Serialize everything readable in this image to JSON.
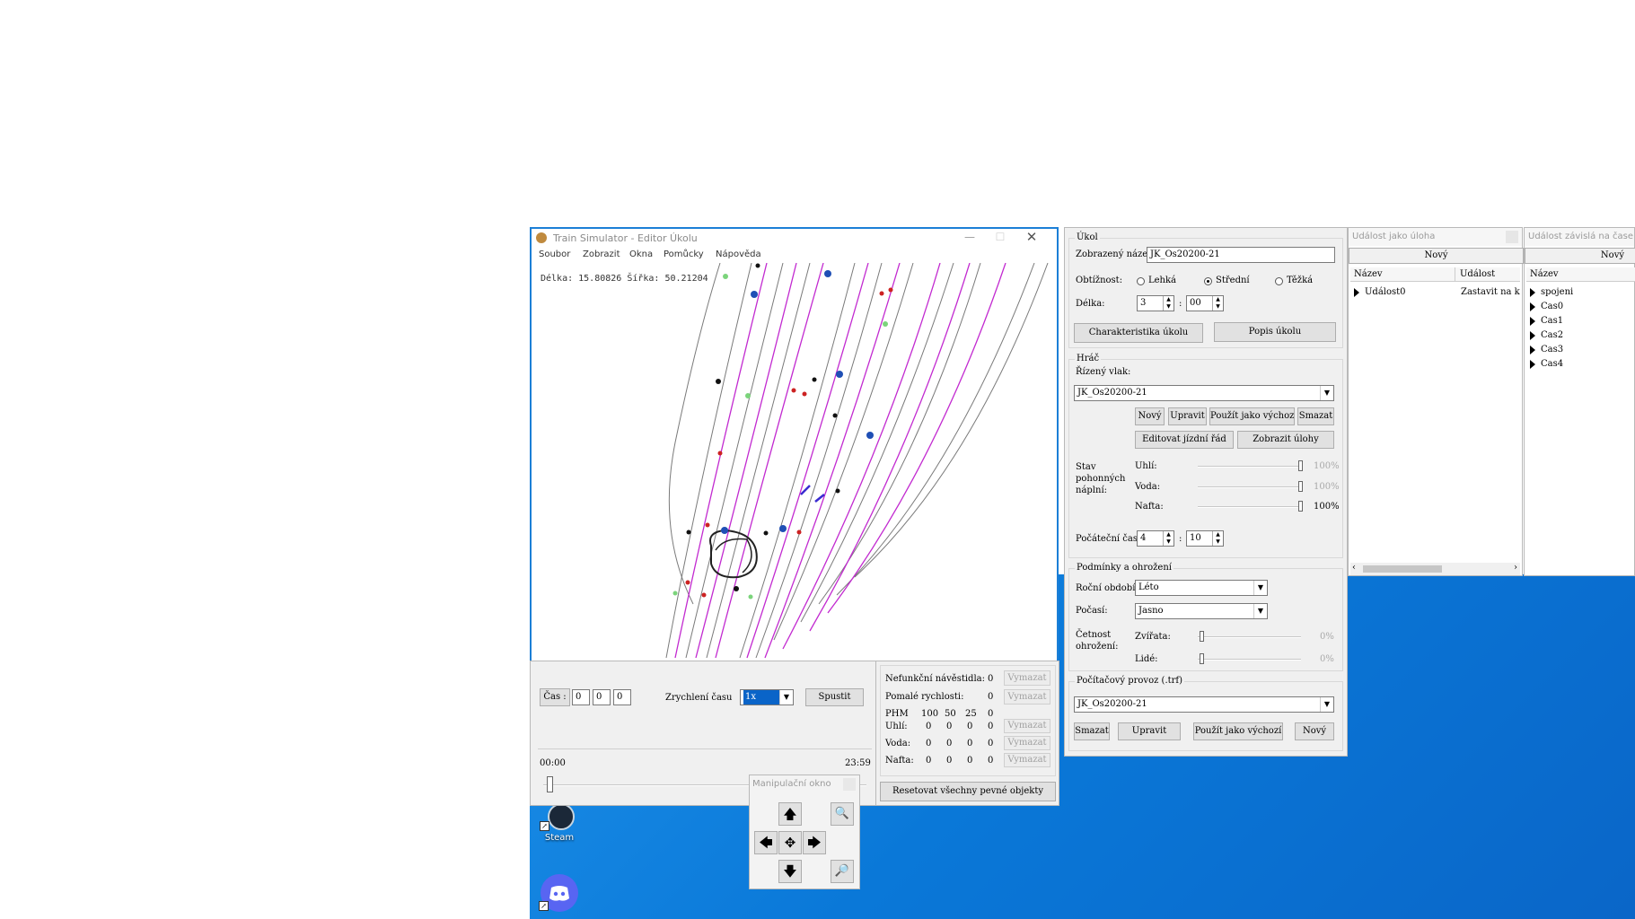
{
  "editor": {
    "title": "Train Simulator - Editor Úkolu",
    "menu": [
      "Soubor",
      "Zobrazit",
      "Okna",
      "Pomůcky",
      "Nápověda"
    ],
    "coords_text": "Délka: 15.80826 Šířka: 50.21204"
  },
  "time_panel": {
    "cas_label": "Čas :",
    "cas_values": [
      "0",
      "0",
      "0"
    ],
    "speed_label": "Zrychlení času",
    "speed_value": "1x",
    "start_button": "Spustit",
    "time_start": "00:00",
    "time_end": "23:59"
  },
  "faults_panel": {
    "rows": [
      {
        "label": "Nefunkční návěstidla:",
        "value": "0",
        "button": "Vymazat"
      },
      {
        "label": "Pomalé rychlosti:",
        "value": "0",
        "button": "Vymazat"
      }
    ],
    "phm_label": "PHM",
    "phm_headers": [
      "100",
      "50",
      "25",
      "0"
    ],
    "fuel_rows": [
      {
        "label": "Uhlí:",
        "values": [
          "0",
          "0",
          "0",
          "0"
        ],
        "button": "Vymazat"
      },
      {
        "label": "Voda:",
        "values": [
          "0",
          "0",
          "0",
          "0"
        ],
        "button": "Vymazat"
      },
      {
        "label": "Nafta:",
        "values": [
          "0",
          "0",
          "0",
          "0"
        ],
        "button": "Vymazat"
      }
    ],
    "reset_button": "Resetovat všechny pevné objekty"
  },
  "manip": {
    "title": "Manipulační okno"
  },
  "task_panel": {
    "ukol_title": "Úkol",
    "display_name_label": "Zobrazený název:",
    "display_name_value": "JK_Os20200-21",
    "difficulty_label": "Obtížnost:",
    "difficulty_options": [
      "Lehká",
      "Střední",
      "Těžká"
    ],
    "difficulty_selected": 1,
    "length_label": "Délka:",
    "length_h": "3",
    "length_m": "00",
    "char_button": "Charakteristika úkolu",
    "desc_button": "Popis úkolu",
    "hrac_title": "Hráč",
    "train_label": "Řízený vlak:",
    "train_value": "JK_Os20200-21",
    "train_buttons": [
      "Nový",
      "Upravit",
      "Použít jako výchozí",
      "Smazat"
    ],
    "timetable_button": "Editovat jízdní řád",
    "show_tasks_button": "Zobrazit úlohy",
    "fuel_label": "Stav pohonných náplní:",
    "fuel_items": [
      {
        "label": "Uhlí:",
        "value": "100%",
        "muted": true
      },
      {
        "label": "Voda:",
        "value": "100%",
        "muted": true
      },
      {
        "label": "Nafta:",
        "value": "100%",
        "muted": false
      }
    ],
    "start_time_label": "Počáteční čas:",
    "start_h": "4",
    "start_m": "10",
    "cond_title": "Podmínky a ohrožení",
    "season_label": "Roční období:",
    "season_value": "Léto",
    "weather_label": "Počasí:",
    "weather_value": "Jasno",
    "threat_label": "Četnost ohrožení:",
    "threat_items": [
      {
        "label": "Zvířata:",
        "value": "0%"
      },
      {
        "label": "Lidé:",
        "value": "0%"
      }
    ],
    "traffic_title": "Počítačový provoz (.trf)",
    "traffic_value": "JK_Os20200-21",
    "traffic_buttons": [
      "Smazat",
      "Upravit",
      "Použít jako výchozí",
      "Nový"
    ]
  },
  "event_task": {
    "title": "Událost jako úloha",
    "new_button": "Nový",
    "col_name": "Název",
    "col_event": "Událost",
    "rows": [
      {
        "name": "Událost0",
        "event": "Zastavit na konc"
      }
    ]
  },
  "event_time": {
    "title": "Událost závislá na čase",
    "new_button": "Nový",
    "col_name": "Název",
    "rows": [
      "spojeni",
      "Cas0",
      "Cas1",
      "Cas2",
      "Cas3",
      "Cas4"
    ]
  },
  "desktop": {
    "steam_label": "Steam"
  }
}
